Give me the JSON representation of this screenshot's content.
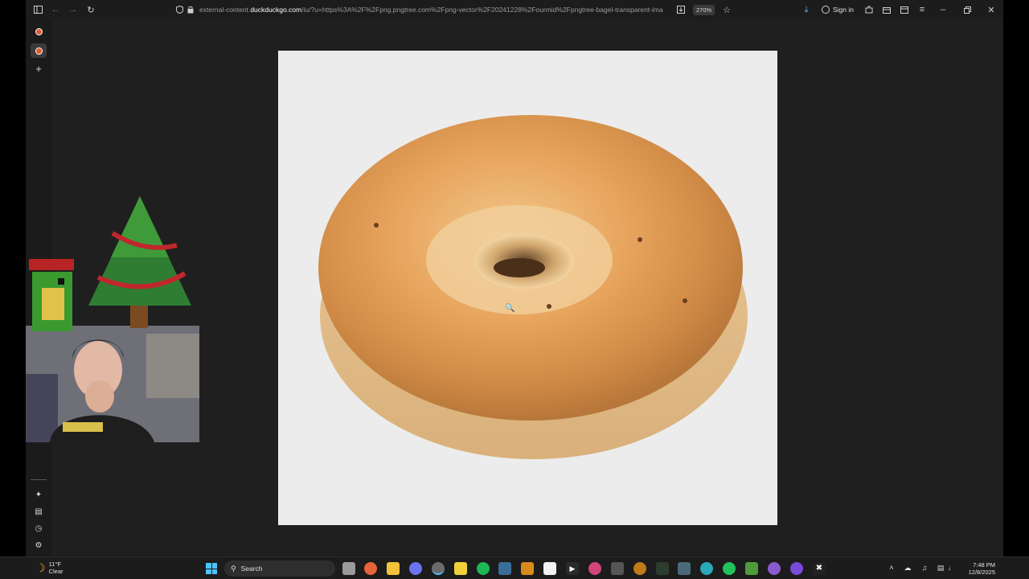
{
  "browser": {
    "url_prefix": "external-content.",
    "url_domain": "duckduckgo.com",
    "url_rest": "/iu/?u=https%3A%2F%2Fpng.pngtree.com%2Fpng-vector%2F20241228%2Fourmid%2Fpngtree-bagel-transparent-ima",
    "zoom": "270%",
    "sign_in": "Sign in"
  },
  "taskbar": {
    "weather_temp": "11°F",
    "weather_desc": "Clear",
    "search_label": "Search",
    "time": "7:48 PM",
    "date": "12/8/2025"
  },
  "colors": {
    "accent": "#4cc2ff",
    "ddg": "#de5833",
    "background": "#1f1f1f"
  }
}
